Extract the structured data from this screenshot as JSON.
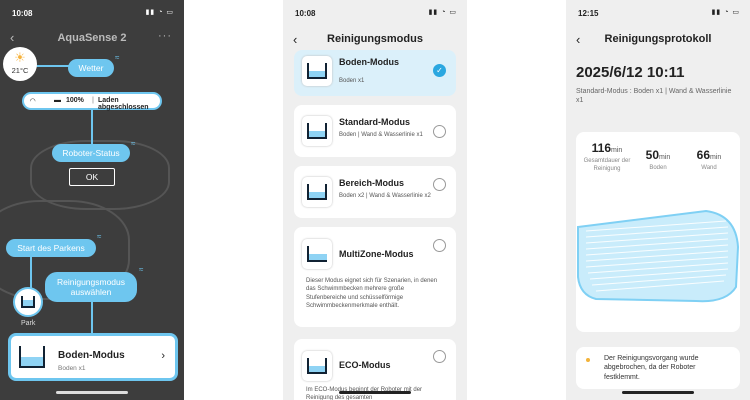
{
  "screen1": {
    "status_time": "10:08",
    "title": "AquaSense 2",
    "back_icon": "chevron-left-icon",
    "more_icon": "ellipsis-icon",
    "weather": {
      "temp": "21°C",
      "label": "Wetter",
      "icon": "sun-icon"
    },
    "status": {
      "battery": "100%",
      "charging_text": "Laden abgeschlossen"
    },
    "robot_status_label": "Roboter-Status",
    "ok_label": "OK",
    "park_start_label": "Start des Parkens",
    "mode_select_label": "Reinigungsmodus auswählen",
    "park_label": "Park",
    "mode_card": {
      "title": "Boden-Modus",
      "subtitle": "Boden x1"
    },
    "accent": "#6ec6ef"
  },
  "screen2": {
    "status_time": "10:08",
    "title": "Reinigungsmodus",
    "options": [
      {
        "title": "Boden-Modus",
        "subtitle": "Boden x1",
        "selected": true
      },
      {
        "title": "Standard-Modus",
        "subtitle": "Boden | Wand & Wasserlinie x1",
        "selected": false
      },
      {
        "title": "Bereich-Modus",
        "subtitle": "Boden x2 | Wand & Wasserlinie x2",
        "selected": false
      },
      {
        "title": "MultiZone-Modus",
        "subtitle": "",
        "description": "Dieser Modus eignet sich für Szenarien, in denen das Schwimmbecken mehrere große Stufenbereiche und schüsselförmige Schwimmbeckenmerkmale enthält.",
        "selected": false
      },
      {
        "title": "ECO-Modus",
        "subtitle": "",
        "description": "Im ECO-Modus beginnt der Roboter mit der Reinigung des gesamten",
        "selected": false
      }
    ]
  },
  "screen3": {
    "status_time": "12:15",
    "title": "Reinigungsprotokoll",
    "date": "2025/6/12 10:11",
    "subtitle": "Standard-Modus : Boden x1 | Wand & Wasserlinie x1",
    "stats": [
      {
        "value": "116",
        "unit": "min",
        "label": "Gesamtdauer der Reinigung"
      },
      {
        "value": "50",
        "unit": "min",
        "label": "Boden"
      },
      {
        "value": "66",
        "unit": "min",
        "label": "Wand"
      }
    ],
    "warning": "Der Reinigungsvorgang wurde abgebrochen, da der Roboter festklemmt."
  }
}
